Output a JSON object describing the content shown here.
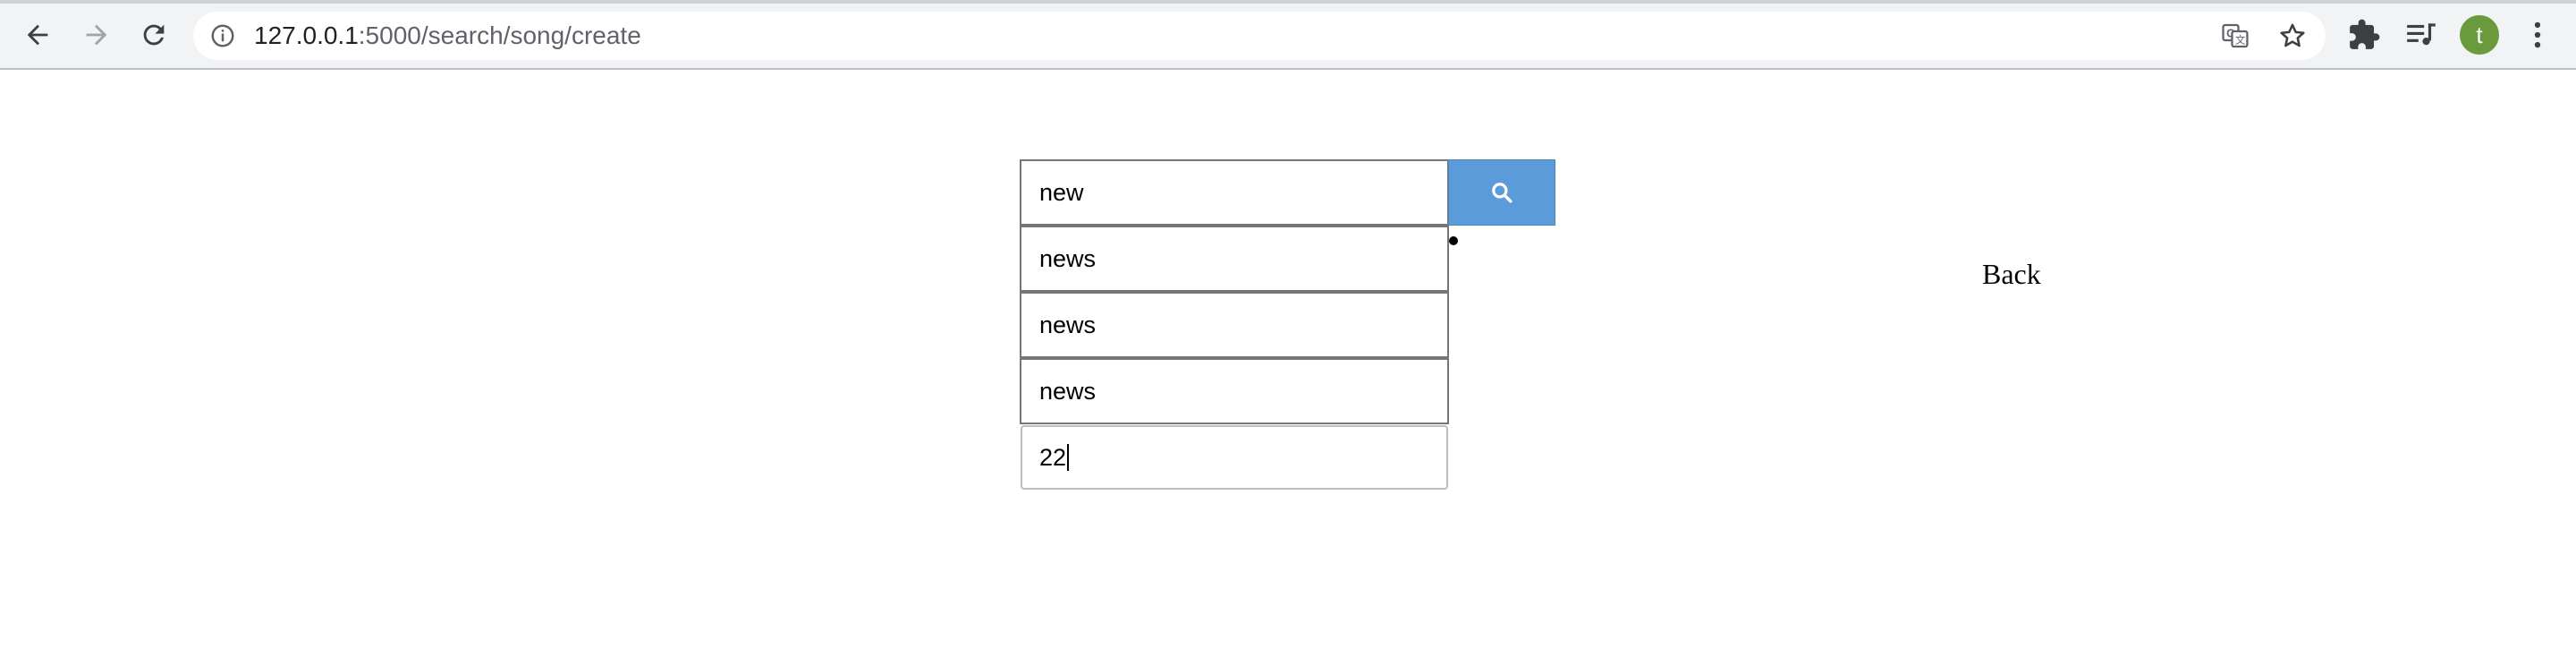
{
  "browser": {
    "url_host": "127.0.0.1",
    "url_path": ":5000/search/song/create",
    "avatar_letter": "t",
    "avatar_color": "#6a9a3b",
    "icons": {
      "back": "arrow-left-icon",
      "forward": "arrow-right-icon",
      "reload": "reload-icon",
      "site_info": "info-icon",
      "translate": "translate-icon",
      "bookmark": "star-icon",
      "extensions": "puzzle-icon",
      "media": "media-queue-icon",
      "menu": "kebab-menu-icon"
    }
  },
  "search": {
    "query_value": "new",
    "button_color": "#5b9bd9",
    "button_icon": "search-icon"
  },
  "suggestions": [
    "news",
    "news",
    "news"
  ],
  "number_field": {
    "value": "22"
  },
  "back_link": {
    "label": "Back"
  }
}
